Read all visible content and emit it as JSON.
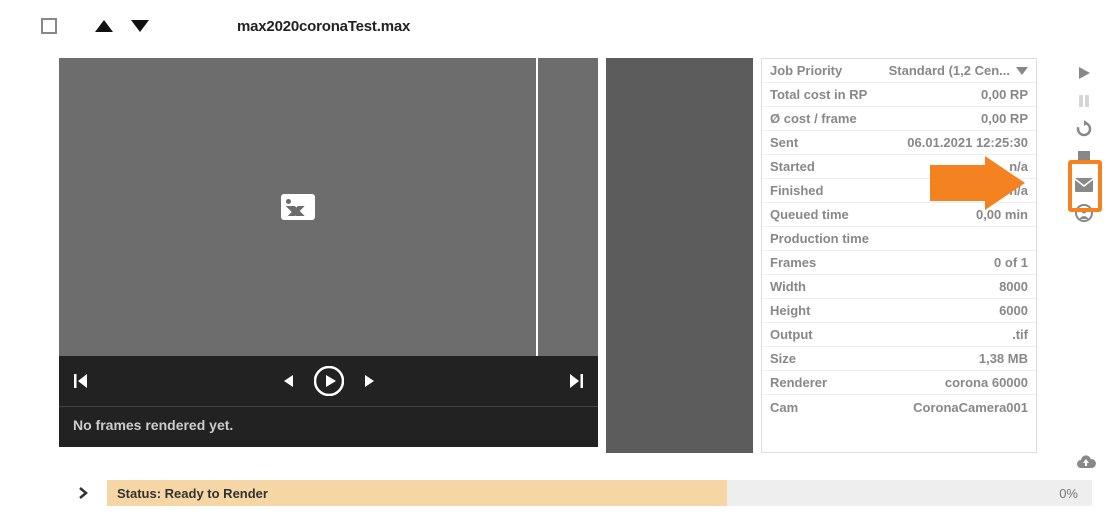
{
  "title": "max2020coronaTest.max",
  "preview": {
    "no_frames": "No frames rendered yet."
  },
  "info": {
    "rows": [
      {
        "label": "Job Priority",
        "value": "Standard (1,2 Cen..."
      },
      {
        "label": "Total cost in RP",
        "value": "0,00 RP"
      },
      {
        "label": "Ø cost / frame",
        "value": "0,00 RP"
      },
      {
        "label": "Sent",
        "value": "06.01.2021 12:25:30"
      },
      {
        "label": "Started",
        "value": "n/a"
      },
      {
        "label": "Finished",
        "value": "n/a"
      },
      {
        "label": "Queued time",
        "value": "0,00 min"
      },
      {
        "label": "Production time",
        "value": ""
      },
      {
        "label": "Frames",
        "value": "0 of 1"
      },
      {
        "label": "Width",
        "value": "8000"
      },
      {
        "label": "Height",
        "value": "6000"
      },
      {
        "label": "Output",
        "value": ".tif"
      },
      {
        "label": "Size",
        "value": "1,38 MB"
      },
      {
        "label": "Renderer",
        "value": "corona 60000"
      },
      {
        "label": "Cam",
        "value": "CoronaCamera001"
      }
    ]
  },
  "status": {
    "label": "Status: Ready to Render",
    "percent": "0%"
  }
}
